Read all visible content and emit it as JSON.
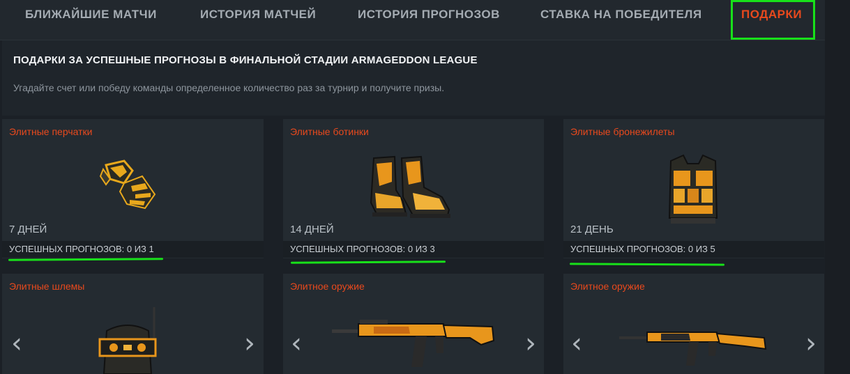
{
  "tabs": [
    {
      "label": "БЛИЖАЙШИЕ МАТЧИ",
      "active": false
    },
    {
      "label": "ИСТОРИЯ МАТЧЕЙ",
      "active": false
    },
    {
      "label": "ИСТОРИЯ ПРОГНОЗОВ",
      "active": false
    },
    {
      "label": "СТАВКА НА ПОБЕДИТЕЛЯ",
      "active": false
    },
    {
      "label": "ПОДАРКИ",
      "active": true
    }
  ],
  "header": {
    "title": "ПОДАРКИ ЗА УСПЕШНЫЕ ПРОГНОЗЫ В ФИНАЛЬНОЙ СТАДИИ ARMAGEDDON LEAGUE",
    "subtitle": "Угадайте счет или победу команды определенное количество раз за турнир и получите призы."
  },
  "cards": [
    {
      "name": "Элитные перчатки",
      "duration": "7 ДНЕЙ",
      "progress": "УСПЕШНЫХ ПРОГНОЗОВ: 0 ИЗ 1",
      "icon": "gloves-icon"
    },
    {
      "name": "Элитные ботинки",
      "duration": "14 ДНЕЙ",
      "progress": "УСПЕШНЫХ ПРОГНОЗОВ: 0 ИЗ 3",
      "icon": "boots-icon"
    },
    {
      "name": "Элитные бронежилеты",
      "duration": "21 ДЕНЬ",
      "progress": "УСПЕШНЫХ ПРОГНОЗОВ: 0 ИЗ 5",
      "icon": "vest-icon"
    },
    {
      "name": "Элитные шлемы",
      "icon": "helmet-icon"
    },
    {
      "name": "Элитное оружие",
      "icon": "smg-icon"
    },
    {
      "name": "Элитное оружие",
      "icon": "rifle-icon"
    }
  ],
  "arrows": {
    "prev": "‹",
    "next": "›"
  },
  "colors": {
    "accent": "#e8491d",
    "highlight": "#18e01a",
    "item_orange": "#e88a1c"
  }
}
